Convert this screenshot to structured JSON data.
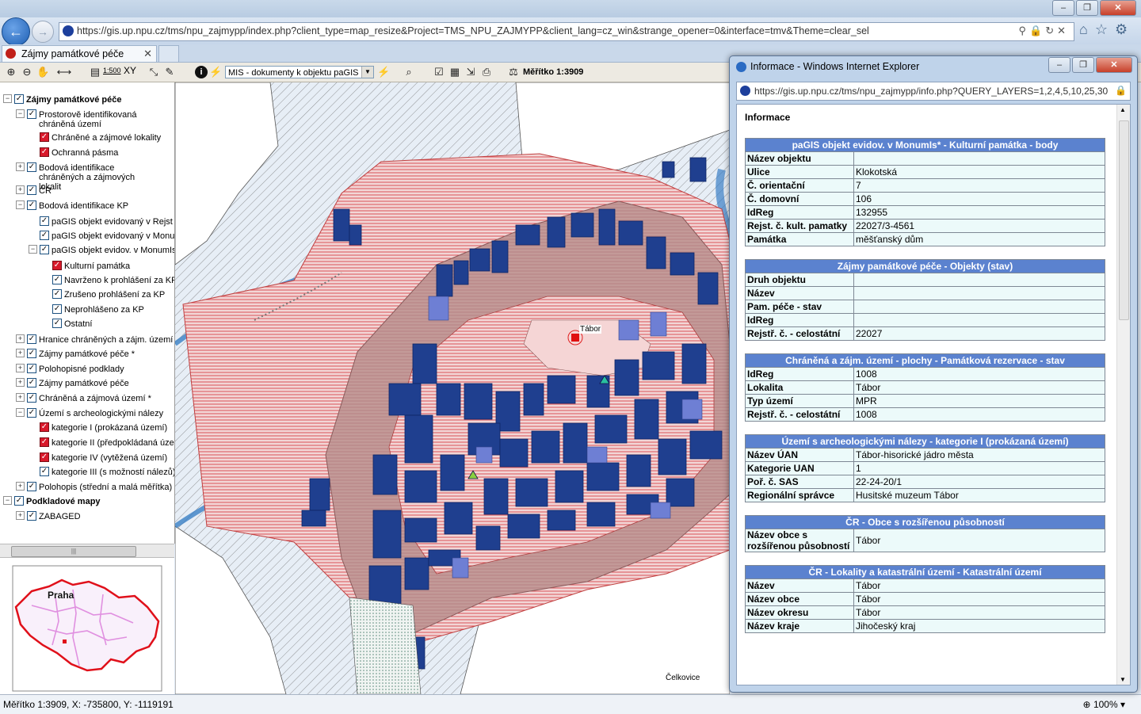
{
  "browser": {
    "url": "https://gis.up.npu.cz/tms/npu_zajmypp/index.php?client_type=map_resize&Project=TMS_NPU_ZAJMYPP&client_lang=cz_win&strange_opener=0&interface=tmv&Theme=clear_sel",
    "tab_title": "Zájmy památkové péče",
    "status_text": "Měřítko 1:3909, X: -735800, Y: -1119191",
    "zoom": "100%"
  },
  "toolbar": {
    "mis_select": "MIS - dokumenty k objektu paGIS",
    "scale_label": "Měřítko 1:3909",
    "scale_ratio": "1:500",
    "xy_label": "XY"
  },
  "tree": [
    {
      "label": "Zájmy památkové péče",
      "bold": true,
      "pm": "minus",
      "cb": "check"
    },
    {
      "label": "Prostorově identifikovaná chráněná území",
      "pm": "minus",
      "cb": "check"
    },
    {
      "label": "Chráněné a zájmové lokality",
      "cb": "red"
    },
    {
      "label": "Ochranná pásma",
      "cb": "red"
    },
    {
      "label": "Bodová identifikace chráněných a zájmových lokalit",
      "pm": "plus",
      "cb": "check"
    },
    {
      "label": "ČR",
      "pm": "plus",
      "cb": "check"
    },
    {
      "label": "Bodová identifikace KP",
      "pm": "minus",
      "cb": "check"
    },
    {
      "label": "paGIS objekt evidovaný v Rejst",
      "cb": "check"
    },
    {
      "label": "paGIS objekt evidovaný v Monum",
      "cb": "check"
    },
    {
      "label": "paGIS objekt evidov. v MonumIs",
      "pm": "minus",
      "cb": "check"
    },
    {
      "label": "Kulturní památka",
      "cb": "red"
    },
    {
      "label": "Navrženo k prohlášení za KP",
      "cb": "check"
    },
    {
      "label": "Zrušeno prohlášení za KP",
      "cb": "check"
    },
    {
      "label": "Neprohlášeno za KP",
      "cb": "check"
    },
    {
      "label": "Ostatní",
      "cb": "check"
    },
    {
      "label": "Hranice chráněných a zájm. území",
      "pm": "plus",
      "cb": "check"
    },
    {
      "label": "Zájmy památkové péče *",
      "pm": "plus",
      "cb": "check"
    },
    {
      "label": "Polohopisné podklady",
      "pm": "plus",
      "cb": "check"
    },
    {
      "label": "Zájmy památkové péče",
      "pm": "plus",
      "cb": "check"
    },
    {
      "label": "Chráněná a zájmová území *",
      "pm": "plus",
      "cb": "check"
    },
    {
      "label": "Území s archeologickými nálezy",
      "pm": "minus",
      "cb": "check"
    },
    {
      "label": "kategorie I (prokázaná území)",
      "cb": "red"
    },
    {
      "label": "kategorie II (předpokládaná úzen",
      "cb": "red"
    },
    {
      "label": "kategorie IV (vytěžená území)",
      "cb": "red"
    },
    {
      "label": "kategorie III (s možností nálezů)",
      "cb": "check"
    },
    {
      "label": "Polohopis (střední a malá měřítka)",
      "pm": "plus",
      "cb": "check"
    },
    {
      "label": "Podkladové mapy",
      "bold": true,
      "pm": "minus",
      "cb": "check"
    },
    {
      "label": "ZABAGED",
      "pm": "plus",
      "cb": "check"
    }
  ],
  "overview": {
    "label": "Praha"
  },
  "map": {
    "labels": [
      "Tábor",
      "Čelkovice"
    ]
  },
  "popup": {
    "title": "Informace - Windows Internet Explorer",
    "url": "https://gis.up.npu.cz/tms/npu_zajmypp/info.php?QUERY_LAYERS=1,2,4,5,10,25,30",
    "heading": "Informace",
    "sections": [
      {
        "title": "paGIS objekt evidov. v MonumIs* - Kulturní památka - body",
        "rows": [
          [
            "Název objektu",
            ""
          ],
          [
            "Ulice",
            "Klokotská"
          ],
          [
            "Č. orientační",
            "7"
          ],
          [
            "Č. domovní",
            "106"
          ],
          [
            "IdReg",
            "132955"
          ],
          [
            "Rejst. č. kult. pamatky",
            "22027/3-4561"
          ],
          [
            "Památka",
            "měšťanský dům"
          ]
        ]
      },
      {
        "title": "Zájmy památkové péče - Objekty (stav)",
        "rows": [
          [
            "Druh objektu",
            ""
          ],
          [
            "Název",
            ""
          ],
          [
            "Pam. péče - stav",
            ""
          ],
          [
            "IdReg",
            ""
          ],
          [
            "Rejstř. č. - celostátní",
            "22027"
          ]
        ]
      },
      {
        "title": "Chráněná a zájm. území - plochy - Památková rezervace - stav",
        "rows": [
          [
            "IdReg",
            "1008"
          ],
          [
            "Lokalita",
            "Tábor"
          ],
          [
            "Typ území",
            "MPR"
          ],
          [
            "Rejstř. č. - celostátní",
            "1008"
          ]
        ]
      },
      {
        "title": "Území s archeologickými nálezy - kategorie I (prokázaná území)",
        "rows": [
          [
            "Název ÚAN",
            "Tábor-hisorické jádro města"
          ],
          [
            "Kategorie UAN",
            "1"
          ],
          [
            "Poř. č. SAS",
            "22-24-20/1"
          ],
          [
            "Regionální správce",
            "Husitské muzeum Tábor"
          ]
        ]
      },
      {
        "title": "ČR - Obce s rozšířenou působností",
        "rows": [
          [
            "Název obce s rozšířenou působností",
            "Tábor"
          ]
        ]
      },
      {
        "title": "ČR - Lokality a katastrální území - Katastrální území",
        "rows": [
          [
            "Název",
            "Tábor"
          ],
          [
            "Název obce",
            "Tábor"
          ],
          [
            "Název okresu",
            "Tábor"
          ],
          [
            "Název kraje",
            "Jihočeský kraj"
          ]
        ]
      }
    ]
  }
}
